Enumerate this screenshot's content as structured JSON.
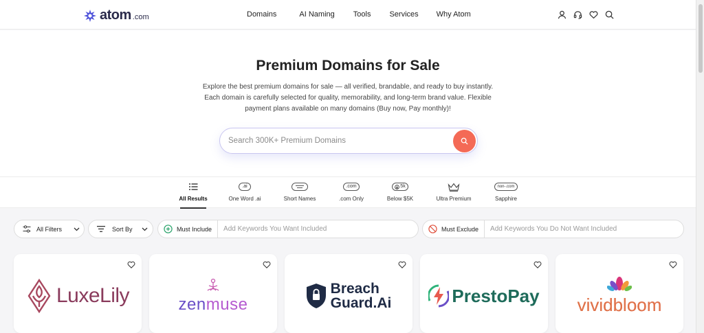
{
  "header": {
    "logo_word": "atom",
    "logo_tld": ".com",
    "nav": [
      "Domains",
      "AI Naming",
      "Tools",
      "Services",
      "Why Atom"
    ],
    "icons": [
      "user-icon",
      "headset-icon",
      "heart-icon",
      "search-icon"
    ]
  },
  "hero": {
    "title": "Premium Domains for Sale",
    "description": "Explore the best premium domains for sale — all verified, brandable, and ready to buy instantly. Each domain is carefully selected for quality, memorability, and long-term brand value. Flexible payment plans available on many domains (Buy now, Pay monthly)!",
    "search_placeholder": "Search 300K+ Premium Domains"
  },
  "tabs": [
    {
      "label": "All Results",
      "icon": "list-icon",
      "active": true
    },
    {
      "label": "One Word .ai",
      "icon": "ai-badge-icon",
      "badge": ".ai"
    },
    {
      "label": "Short Names",
      "icon": "short-names-icon"
    },
    {
      "label": ".com Only",
      "icon": "com-badge-icon",
      "badge": ".com"
    },
    {
      "label": "Below $5K",
      "icon": "below-5k-icon",
      "badge": "5k"
    },
    {
      "label": "Ultra Premium",
      "icon": "crown-icon"
    },
    {
      "label": "Sapphire",
      "icon": "non-com-badge-icon",
      "badge": "non-.com"
    }
  ],
  "filters": {
    "all_filters": "All Filters",
    "sort_by": "Sort By",
    "must_include": "Must Include",
    "must_include_placeholder": "Add Keywords You Want Included",
    "must_exclude": "Must Exclude",
    "must_exclude_placeholder": "Add Keywords You Do Not Want Included"
  },
  "cards": [
    {
      "name": "LuxeLily",
      "color": "#8a3b5c"
    },
    {
      "name_a": "zen",
      "name_b": "muse",
      "color": "#6a4fc7"
    },
    {
      "name_a": "Breach",
      "name_b": "Guard.Ai",
      "color": "#1f2b45"
    },
    {
      "name": "PrestoPay",
      "color": "#1e6b5a"
    },
    {
      "name": "vividbloom",
      "color": "#e0734a"
    }
  ],
  "colors": {
    "accent": "#f46a56",
    "search_border": "#c9c6f0",
    "logo_purple": "#4b4fd9"
  }
}
